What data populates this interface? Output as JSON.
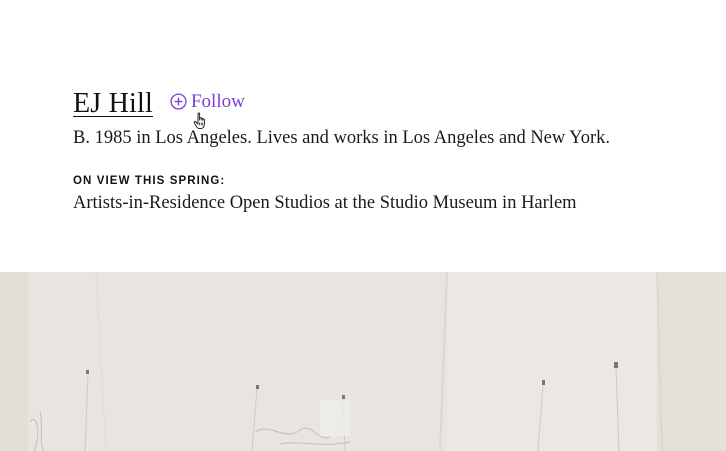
{
  "artist": {
    "name": "EJ Hill",
    "follow_label": "Follow",
    "bio": "B. 1985 in Los Angeles. Lives and works in Los Angeles and New York."
  },
  "on_view": {
    "heading": "ON VIEW THIS SPRING:",
    "text": "Artists-in-Residence Open Studios at the Studio Museum in Harlem"
  },
  "colors": {
    "accent": "#7b3cdc",
    "text": "#1a1a1a",
    "image_wall": "#e8e5e0"
  },
  "icons": {
    "follow": "plus-circle-icon",
    "cursor": "hand-pointer-icon"
  }
}
